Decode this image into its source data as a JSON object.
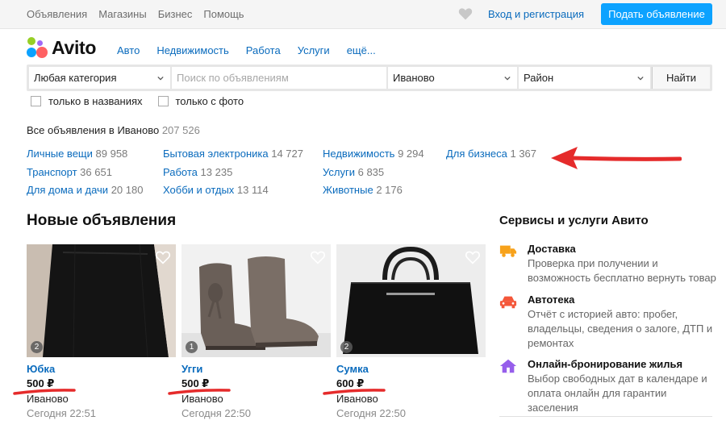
{
  "topbar": {
    "nav": [
      "Объявления",
      "Магазины",
      "Бизнес",
      "Помощь"
    ],
    "login": "Вход и регистрация",
    "post_button": "Подать объявление"
  },
  "logo": {
    "text": "Avito",
    "colors": [
      "#97cf26",
      "#a169f7",
      "#ff6163",
      "#0ca2ff"
    ]
  },
  "mainnav": [
    "Авто",
    "Недвижимость",
    "Работа",
    "Услуги",
    "ещё..."
  ],
  "search": {
    "category": "Любая категория",
    "query_placeholder": "Поиск по объявлениям",
    "city": "Иваново",
    "district": "Район",
    "submit": "Найти"
  },
  "filters": {
    "titles_only": "только в названиях",
    "with_photo": "только с фото"
  },
  "summary": {
    "label": "Все объявления в Иваново",
    "count": "207 526"
  },
  "categories": [
    [
      {
        "name": "Личные вещи",
        "count": "89 958"
      },
      {
        "name": "Транспорт",
        "count": "36 651"
      },
      {
        "name": "Для дома и дачи",
        "count": "20 180"
      }
    ],
    [
      {
        "name": "Бытовая электроника",
        "count": "14 727"
      },
      {
        "name": "Работа",
        "count": "13 235"
      },
      {
        "name": "Хобби и отдых",
        "count": "13 114"
      }
    ],
    [
      {
        "name": "Недвижимость",
        "count": "9 294"
      },
      {
        "name": "Услуги",
        "count": "6 835"
      },
      {
        "name": "Животные",
        "count": "2 176"
      }
    ],
    [
      {
        "name": "Для бизнеса",
        "count": "1 367"
      }
    ]
  ],
  "new_ads": {
    "heading": "Новые объявления",
    "items": [
      {
        "title": "Юбка",
        "price": "500 ₽",
        "city": "Иваново",
        "time": "Сегодня 22:51",
        "photos": "2"
      },
      {
        "title": "Угги",
        "price": "500 ₽",
        "city": "Иваново",
        "time": "Сегодня 22:50",
        "photos": "1"
      },
      {
        "title": "Сумка",
        "price": "600 ₽",
        "city": "Иваново",
        "time": "Сегодня 22:50",
        "photos": "2"
      }
    ]
  },
  "services": {
    "heading": "Сервисы и услуги Авито",
    "items": [
      {
        "name": "Доставка",
        "desc": "Проверка при получении и возможность бесплатно вернуть товар",
        "icon": "truck-icon",
        "color": "#f7a21b"
      },
      {
        "name": "Автотека",
        "desc": "Отчёт с историей авто: пробег, владельцы, сведения о залоге, ДТП и ремонтах",
        "icon": "car-icon",
        "color": "#f4573a"
      },
      {
        "name": "Онлайн-бронирование жилья",
        "desc": "Выбор свободных дат в календаре и оплата онлайн для гарантии заселения",
        "icon": "house-icon",
        "color": "#965eeb"
      }
    ]
  },
  "accent_colors": {
    "link": "#0a6bbd",
    "button": "#0ca2ff",
    "annotation": "#e52b2b"
  }
}
